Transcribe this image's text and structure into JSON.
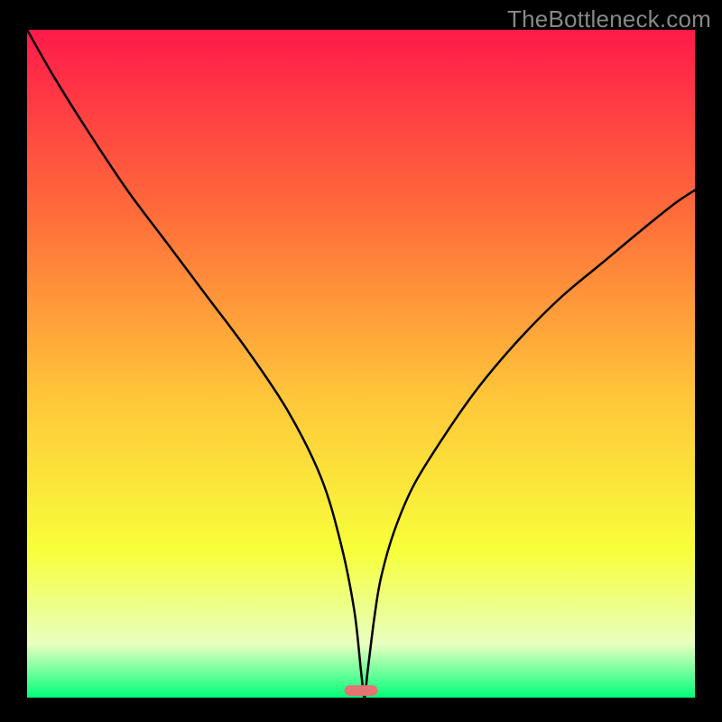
{
  "watermark": "TheBottleneck.com",
  "colors": {
    "frame": "#000000",
    "gradient_top": "#ff1a4a",
    "gradient_upper_mid": "#ff6e3a",
    "gradient_mid": "#ffc63a",
    "gradient_lower_mid": "#f7ff3a",
    "gradient_lower": "#e8ffc0",
    "gradient_bottom": "#00ff7a",
    "curve": "#000000",
    "marker": "#e57373"
  },
  "chart_data": {
    "type": "line",
    "title": "",
    "xlabel": "",
    "ylabel": "",
    "xlim": [
      0,
      100
    ],
    "ylim": [
      0,
      100
    ],
    "series": [
      {
        "name": "bottleneck-curve",
        "x": [
          0,
          4,
          9,
          15,
          21,
          27,
          33,
          39,
          44,
          47,
          49,
          50,
          50.5,
          51,
          52,
          53,
          55,
          58,
          63,
          68,
          74,
          80,
          86,
          92,
          97,
          100
        ],
        "values": [
          100,
          93,
          85,
          76,
          68,
          60,
          52,
          43,
          33,
          23,
          13,
          4,
          0,
          4,
          12,
          18,
          25,
          32,
          40,
          47,
          54,
          60,
          65,
          70,
          74,
          76
        ]
      }
    ],
    "marker": {
      "x_center": 50,
      "width": 5,
      "height": 1.6,
      "color": "#e57373"
    },
    "annotations": []
  }
}
